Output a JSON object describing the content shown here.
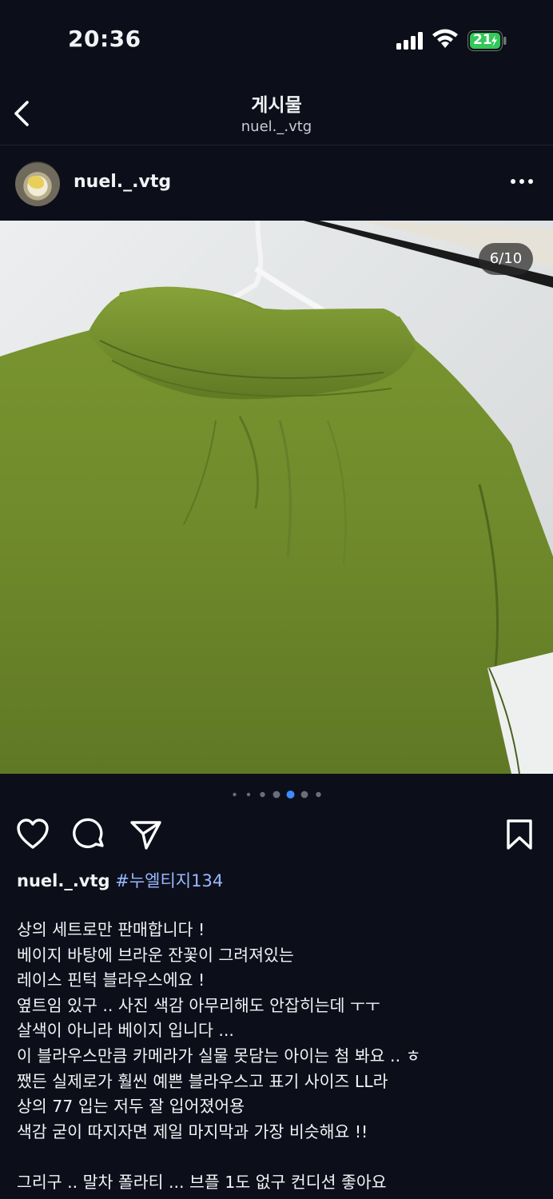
{
  "status_bar": {
    "time": "20:36",
    "battery_level": "21"
  },
  "nav": {
    "title": "게시물",
    "subtitle": "nuel._.vtg"
  },
  "post": {
    "username": "nuel._.vtg",
    "image_counter": "6/10",
    "carousel": {
      "total_dots": 7,
      "active_dot": 5
    },
    "caption": {
      "username": "nuel._.vtg",
      "hashtag": "#누엘티지134",
      "lines": [
        "상의 세트로만 판매합니다 !",
        "베이지 바탕에 브라운 잔꽃이 그려져있는",
        "레이스 핀턱 블라우스에요 !",
        "옆트임 있구 .. 사진 색감 아무리해도 안잡히는데 ㅜㅜ",
        "살색이 아니라 베이지 입니다 ...",
        "이 블라우스만큼 카메라가 실물 못담는 아이는 첨 봐요 .. ㅎ",
        "쨌든 실제로가 훨씬 예쁜 블라우스고 표기 사이즈 LL라",
        "상의 77 입는 저두 잘 입어졌어용",
        "색감 굳이 따지자면 제일 마지막과 가장 비슷해요 !!",
        "",
        "그리구 .. 말차 폴라티 ... 브플 1도 없구 컨디션 좋아요"
      ]
    }
  },
  "colors": {
    "background": "#0c0f1a",
    "hashtag": "#9ab8ff",
    "active_dot": "#3d8bff",
    "battery_fill": "#34c759",
    "shirt_green": "#6e8a2a"
  }
}
